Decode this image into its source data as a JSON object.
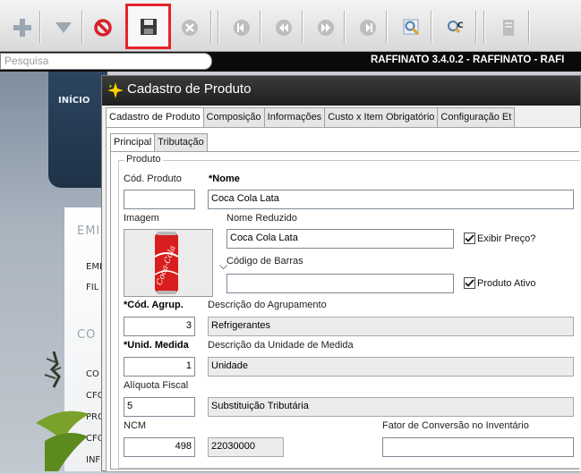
{
  "toolbar": {
    "buttons": [
      {
        "name": "add-icon",
        "color": "#9aa6b2"
      },
      {
        "name": "filter-icon",
        "color": "#9aa6b2"
      },
      {
        "name": "cancel-icon",
        "color": "#d6222a"
      },
      {
        "name": "save-icon",
        "color": "#333333",
        "highlighted": true
      },
      {
        "name": "delete-icon",
        "color": "#b9b9b9"
      },
      {
        "name": "first-record-icon",
        "color": "#b9b9b9"
      },
      {
        "name": "previous-record-icon",
        "color": "#b9b9b9"
      },
      {
        "name": "next-record-icon",
        "color": "#b9b9b9"
      },
      {
        "name": "last-record-icon",
        "color": "#b9b9b9"
      },
      {
        "name": "search-icon",
        "color": "#4e7fae"
      },
      {
        "name": "search-code-icon",
        "color": "#4e7fae"
      },
      {
        "name": "report-icon",
        "color": "#b9b9b9"
      }
    ]
  },
  "topbar": {
    "search_placeholder": "Pesquisa",
    "app_title": "RAFFINATO 3.4.0.2 - RAFFINATO - RAFI"
  },
  "background": {
    "inicio": "INÍCIO",
    "section1": "EMI",
    "section1_items": [
      "EMP",
      "FIL"
    ],
    "section2": "CO",
    "section2_items": [
      "CO",
      "CFO",
      "PRO",
      "CFO",
      "INF"
    ]
  },
  "dialog": {
    "title": "Cadastro de Produto",
    "tabs": [
      "Cadastro de Produto",
      "Composição",
      "Informações",
      "Custo x Item Obrigatório",
      "Configuração Et"
    ],
    "subtabs": [
      "Principal",
      "Tributação"
    ],
    "group_title": "Produto",
    "fields": {
      "cod_produto_label": "Cód. Produto",
      "cod_produto_value": "",
      "nome_label": "*Nome",
      "nome_value": "Coca Cola Lata",
      "imagem_label": "Imagem",
      "nome_reduzido_label": "Nome Reduzido",
      "nome_reduzido_value": "Coca Cola Lata",
      "exibir_preco_label": "Exibir Preço?",
      "exibir_preco_checked": true,
      "codigo_barras_label": "Código de Barras",
      "codigo_barras_value": "",
      "produto_ativo_label": "Produto Ativo",
      "produto_ativo_checked": true,
      "cod_agrup_label": "*Cód. Agrup.",
      "desc_agrup_label": "Descrição do Agrupamento",
      "cod_agrup_value": "3",
      "desc_agrup_value": "Refrigerantes",
      "unid_medida_label": "*Unid. Medida",
      "desc_unid_label": "Descrição da Unidade de Medida",
      "unid_medida_value": "1",
      "desc_unid_value": "Unidade",
      "aliquota_label": "Alíquota Fiscal",
      "aliquota_value": "5",
      "aliquota_desc_value": "Substituição Tributária",
      "ncm_label": "NCM",
      "ncm_code_value": "498",
      "ncm_value": "22030000",
      "fator_label": "Fator de Conversão no Inventário",
      "fator_value": ""
    },
    "product_image_text": "Coca-Cola",
    "colors": {
      "can_red": "#d81e1e",
      "title_bar": "#262626"
    }
  }
}
